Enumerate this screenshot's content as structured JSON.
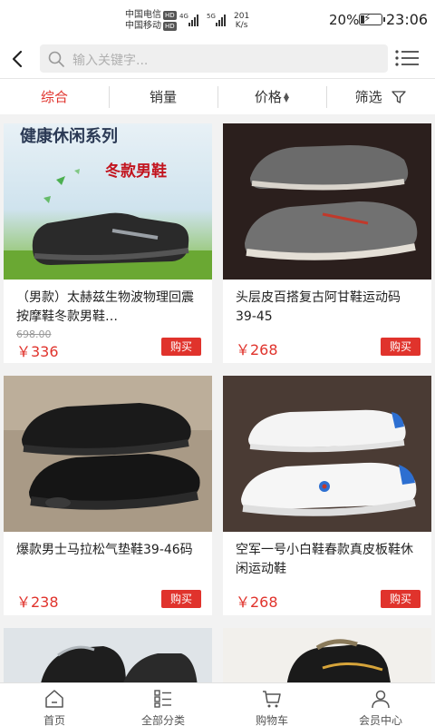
{
  "status_bar": {
    "carrier1": "中国电信",
    "carrier2": "中国移动",
    "hd": "HD",
    "sig1": "4G",
    "sig2": "5G",
    "speed_value": "201",
    "speed_unit": "K/s",
    "battery_percent": "20%",
    "battery_level": 0.2,
    "time": "23:06"
  },
  "header": {
    "search_placeholder": "输入关键字..."
  },
  "filters": [
    {
      "label": "综合",
      "active": true
    },
    {
      "label": "销量",
      "active": false
    },
    {
      "label": "价格",
      "active": false
    },
    {
      "label": "筛选",
      "active": false
    }
  ],
  "products": [
    {
      "title": "（男款）太赫兹生物波物理回震按摩鞋冬款男鞋…",
      "old_price": "698.00",
      "price": "￥336",
      "buy_label": "购买",
      "banner_title": "健康休闲系列",
      "banner_tag": "冬款男鞋",
      "colors": {
        "bg_top": "#cfe3ee",
        "bg_bottom": "#8bc34a",
        "shoe": "#2a2a2a"
      }
    },
    {
      "title": "头层皮百搭复古阿甘鞋运动码39-45",
      "price": "￥268",
      "buy_label": "购买",
      "colors": {
        "bg": "#2b1f1d",
        "shoe": "#6b6b6b"
      }
    },
    {
      "title": "爆款男士马拉松气垫鞋39-46码",
      "price": "￥238",
      "buy_label": "购买",
      "colors": {
        "bg": "#a99a86",
        "shoe": "#151515"
      }
    },
    {
      "title": "空军一号小白鞋春款真皮板鞋休闲运动鞋",
      "price": "￥268",
      "buy_label": "购买",
      "colors": {
        "bg": "#4a3b34",
        "shoe": "#f4f4f4",
        "accent": "#2d6fd1"
      }
    },
    {
      "colors": {
        "bg": "#dfe4e8",
        "shoe": "#1e1e1e"
      }
    },
    {
      "colors": {
        "bg": "#f2f0ec",
        "shoe": "#1a1a1a",
        "accent": "#d6a43a"
      }
    }
  ],
  "bottom_nav": [
    {
      "label": "首页",
      "icon": "home-icon"
    },
    {
      "label": "全部分类",
      "icon": "category-icon"
    },
    {
      "label": "购物车",
      "icon": "cart-icon"
    },
    {
      "label": "会员中心",
      "icon": "user-icon"
    }
  ],
  "theme": {
    "accent": "#e0332c"
  }
}
